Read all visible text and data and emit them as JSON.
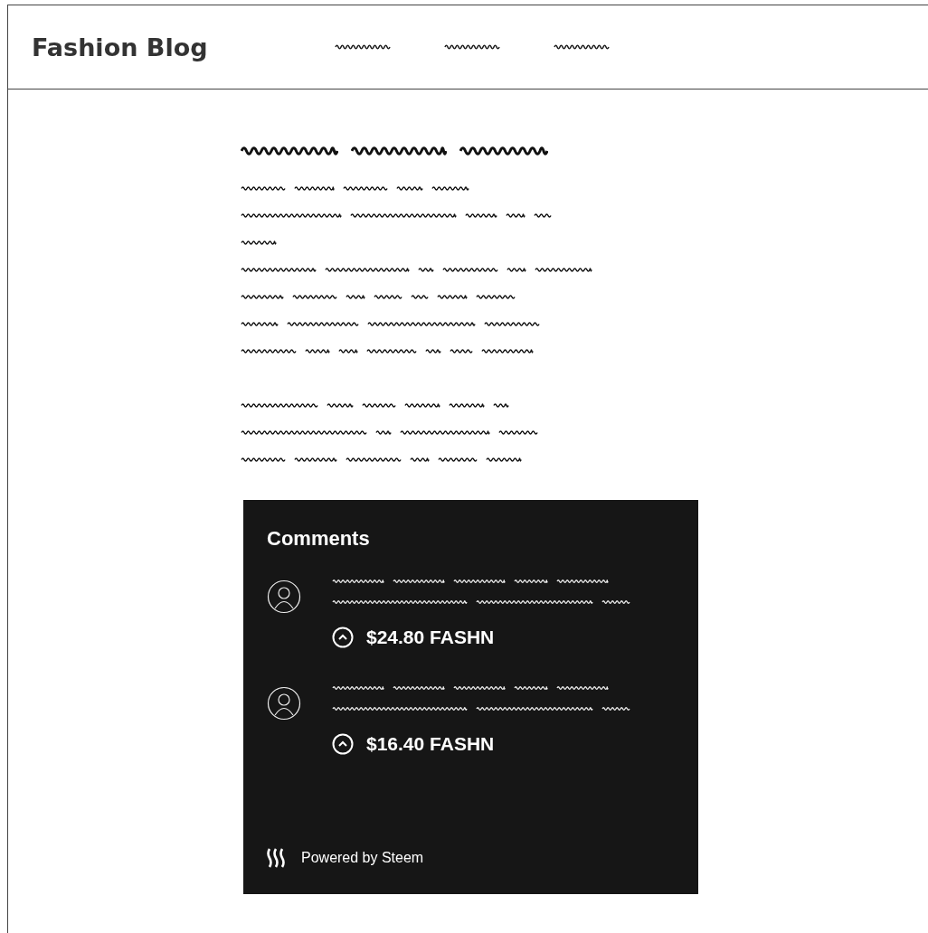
{
  "header": {
    "title": "Fashion Blog"
  },
  "comments_section": {
    "heading": "Comments",
    "comments": [
      {
        "reward": "$24.80 FASHN"
      },
      {
        "reward": "$16.40 FASHN"
      }
    ],
    "footer": "Powered by Steem"
  }
}
